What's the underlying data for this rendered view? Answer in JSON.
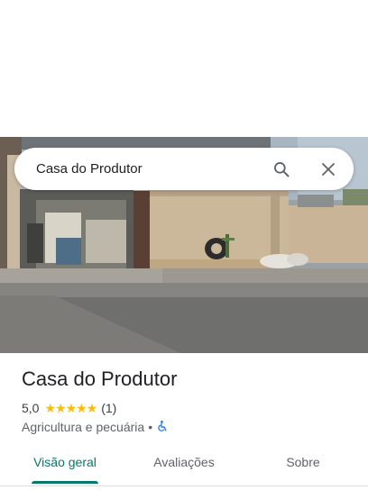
{
  "search": {
    "query": "Casa do Produtor"
  },
  "place": {
    "name": "Casa do Produtor",
    "rating": "5,0",
    "stars": "★★★★★",
    "review_count": "(1)",
    "category": "Agricultura e pecuária",
    "separator": "•"
  },
  "tabs": [
    {
      "label": "Visão geral",
      "active": true
    },
    {
      "label": "Avaliações",
      "active": false
    },
    {
      "label": "Sobre",
      "active": false
    }
  ],
  "colors": {
    "accent": "#00796b",
    "star": "#fbbc04",
    "accessibility": "#1a73e8"
  },
  "icons": {
    "search": "search-icon",
    "close": "close-icon",
    "accessibility": "wheelchair-icon"
  }
}
